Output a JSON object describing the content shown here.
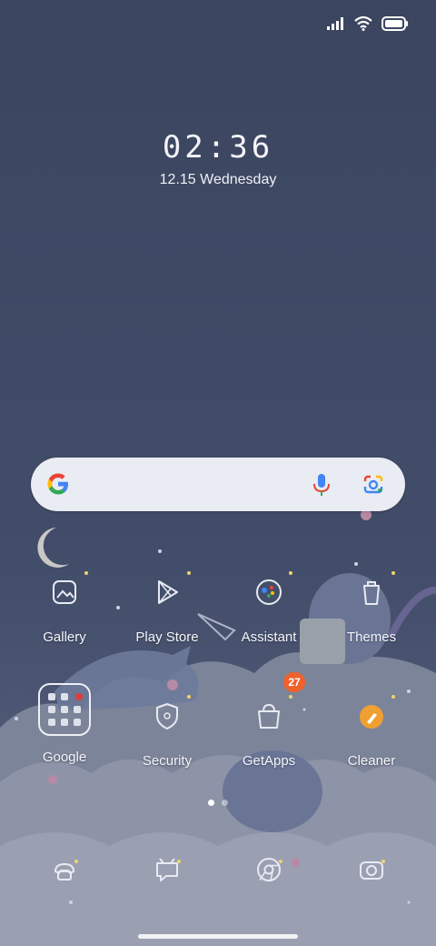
{
  "lock": {
    "time": "02:36",
    "date": "12.15 Wednesday"
  },
  "status": {
    "signal_icon": "signal-icon",
    "wifi_icon": "wifi-icon",
    "battery_icon": "battery-icon"
  },
  "search": {
    "google_icon": "google-g-icon",
    "mic_icon": "microphone-icon",
    "lens_icon": "google-lens-icon"
  },
  "apps_row1": [
    {
      "label": "Gallery",
      "icon": "gallery-icon"
    },
    {
      "label": "Play Store",
      "icon": "play-store-icon"
    },
    {
      "label": "Assistant",
      "icon": "assistant-icon"
    },
    {
      "label": "Themes",
      "icon": "themes-icon"
    }
  ],
  "apps_row2": [
    {
      "label": "Google",
      "icon": "folder-icon"
    },
    {
      "label": "Security",
      "icon": "security-icon"
    },
    {
      "label": "GetApps",
      "icon": "getapps-icon",
      "badge": "27"
    },
    {
      "label": "Cleaner",
      "icon": "cleaner-icon"
    }
  ],
  "dock": [
    {
      "icon": "phone-icon"
    },
    {
      "icon": "messages-icon"
    },
    {
      "icon": "chrome-icon"
    },
    {
      "icon": "camera-icon"
    }
  ],
  "pager": {
    "pages": 2,
    "current": 1
  },
  "colors": {
    "background": "#3c4660",
    "badge": "#f0622d",
    "cleaner": "#f0a030"
  }
}
